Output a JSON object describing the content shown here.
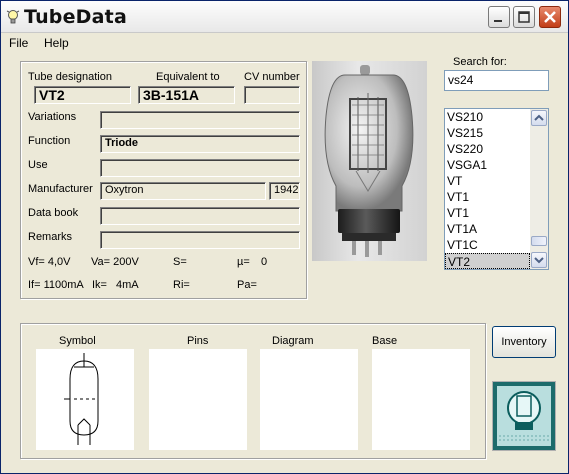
{
  "window": {
    "title": "TubeData"
  },
  "menu": {
    "file": "File",
    "help": "Help"
  },
  "tube": {
    "designation_label": "Tube designation",
    "designation": "VT2",
    "equivalent_label": "Equivalent to",
    "equivalent": "3B-151A",
    "cv_label": "CV number",
    "cv": "",
    "variations_label": "Variations",
    "variations": "",
    "function_label": "Function",
    "function": "Triode",
    "use_label": "Use",
    "use": "",
    "manufacturer_label": "Manufacturer",
    "manufacturer": "Oxytron",
    "year": "1942",
    "databook_label": "Data book",
    "databook": "",
    "remarks_label": "Remarks",
    "remarks": "",
    "params": {
      "vf": "Vf= 4,0V",
      "va": "Va= 200V",
      "s": "S=",
      "mu": "µ=",
      "mu_value": "0",
      "if": "If= 1100mA",
      "ik": "Ik=",
      "ik_value": "4mA",
      "ri": "Ri=",
      "pa": "Pa="
    }
  },
  "search": {
    "label": "Search for:",
    "value": "vs24",
    "results": [
      "VS210",
      "VS215",
      "VS220",
      "VSGA1",
      "VT",
      "VT1",
      "VT1",
      "VT1A",
      "VT1C",
      "VT2"
    ],
    "selected_index": 9
  },
  "bottom": {
    "symbol_label": "Symbol",
    "pins_label": "Pins",
    "diagram_label": "Diagram",
    "base_label": "Base"
  },
  "buttons": {
    "inventory": "Inventory"
  },
  "colors": {
    "title_bg": "#f4f4f4",
    "close_red": "#c84a24",
    "selection": "#d0d0d0"
  }
}
